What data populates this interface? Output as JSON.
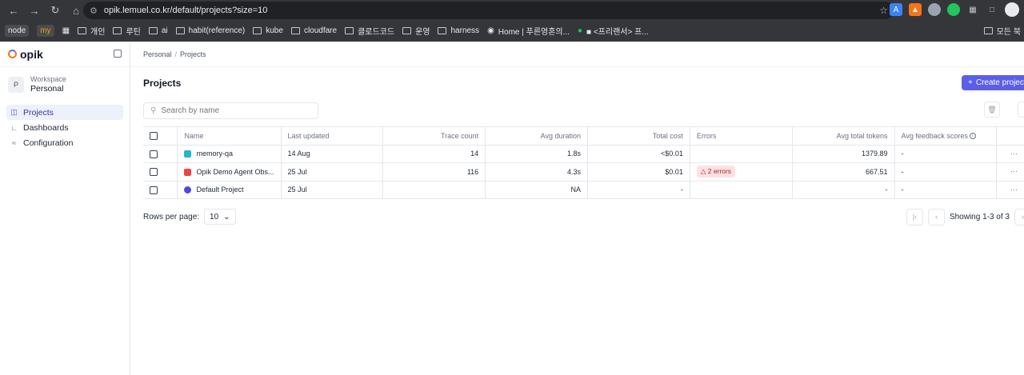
{
  "browser": {
    "url": "opik.lemuel.co.kr/default/projects?size=10",
    "bookmarks": [
      "node",
      "my",
      "개인",
      "루틴",
      "ai",
      "habit(reference)",
      "kube",
      "cloudfare",
      "클로드코드",
      "운영",
      "harness",
      "Home | 푸른영혼의...",
      "■ <프리랜서> 프...",
      "모든 북"
    ]
  },
  "sidebar": {
    "logo": "opik",
    "workspace_caption": "Workspace",
    "workspace_name": "Personal",
    "workspace_initial": "P",
    "items": [
      {
        "label": "Projects",
        "icon": "projects-icon",
        "active": true
      },
      {
        "label": "Dashboards",
        "icon": "chart-icon",
        "active": false
      },
      {
        "label": "Configuration",
        "icon": "sliders-icon",
        "active": false
      }
    ]
  },
  "breadcrumb": {
    "root": "Personal",
    "current": "Projects"
  },
  "page": {
    "title": "Projects",
    "create_label": "Create project",
    "search_placeholder": "Search by name"
  },
  "table": {
    "columns": [
      "Name",
      "Last updated",
      "Trace count",
      "Avg duration",
      "Total cost",
      "Errors",
      "Avg total tokens",
      "Avg feedback scores"
    ],
    "rows": [
      {
        "name": "memory-qa",
        "last_updated": "14 Aug",
        "trace_count": "14",
        "avg_duration": "1.8s",
        "total_cost": "<$0.01",
        "errors": "",
        "avg_tokens": "1379.89",
        "feedback": "-",
        "icon_color": "#22b8c9"
      },
      {
        "name": "Opik Demo Agent Obs...",
        "last_updated": "25 Jul",
        "trace_count": "116",
        "avg_duration": "4.3s",
        "total_cost": "$0.01",
        "errors": "2 errors",
        "avg_tokens": "667.51",
        "feedback": "-",
        "icon_color": "#ef4444"
      },
      {
        "name": "Default Project",
        "last_updated": "25 Jul",
        "trace_count": "",
        "avg_duration": "NA",
        "total_cost": "-",
        "errors": "",
        "avg_tokens": "-",
        "feedback": "-",
        "icon_color": "#4f46e5"
      }
    ]
  },
  "pagination": {
    "rows_per_page_label": "Rows per page:",
    "rows_per_page": "10",
    "showing": "Showing 1-3 of 3"
  },
  "colors": {
    "accent": "#5b5fe8",
    "error_bg": "#fde2e2",
    "error_text": "#b91c1c"
  }
}
